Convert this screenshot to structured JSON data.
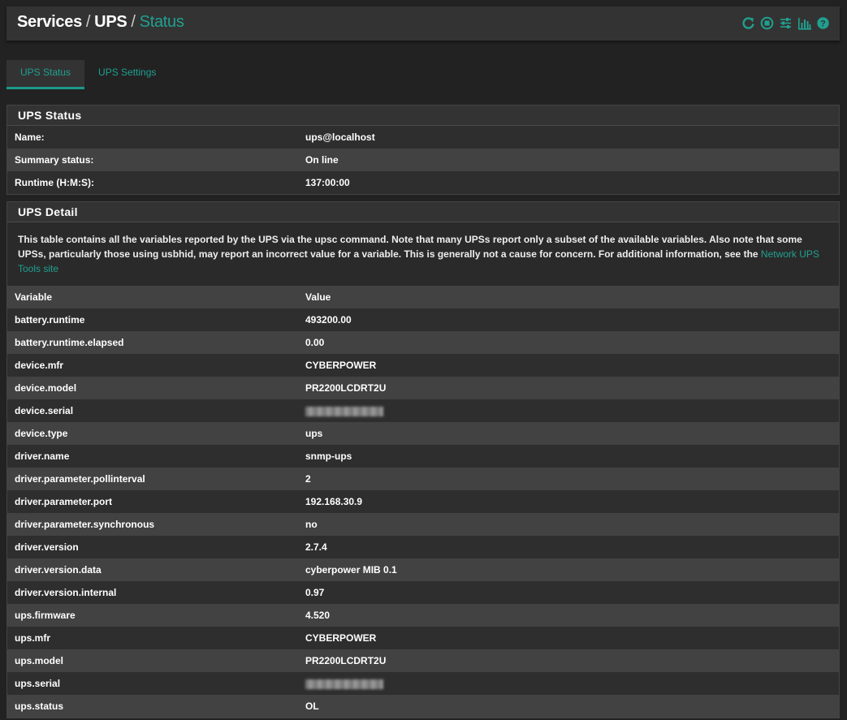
{
  "breadcrumb": {
    "services": "Services",
    "sep1": "/",
    "ups": "UPS",
    "sep2": "/",
    "status": "Status"
  },
  "header_icons": [
    "restart-icon",
    "stop-icon",
    "settings-sliders-icon",
    "chart-icon",
    "help-icon"
  ],
  "tabs": [
    {
      "label": "UPS Status"
    },
    {
      "label": "UPS Settings"
    }
  ],
  "status_panel": {
    "title": "UPS Status",
    "rows": [
      {
        "key": "Name:",
        "value": "ups@localhost"
      },
      {
        "key": "Summary status:",
        "value": "On line"
      },
      {
        "key": "Runtime (H:M:S):",
        "value": "137:00:00"
      }
    ]
  },
  "detail_panel": {
    "title": "UPS Detail",
    "description": "This table contains all the variables reported by the UPS via the upsc command. Note that many UPSs report only a subset of the available variables. Also note that some UPSs, particularly those using usbhid, may report an incorrect value for a variable. This is generally not a cause for concern. For additional information, see the",
    "link_text": "Network UPS Tools site",
    "col_variable": "Variable",
    "col_value": "Value",
    "rows": [
      {
        "key": "battery.runtime",
        "value": "493200.00"
      },
      {
        "key": "battery.runtime.elapsed",
        "value": "0.00"
      },
      {
        "key": "device.mfr",
        "value": "CYBERPOWER"
      },
      {
        "key": "device.model",
        "value": "PR2200LCDRT2U"
      },
      {
        "key": "device.serial",
        "value": "",
        "redacted": true
      },
      {
        "key": "device.type",
        "value": "ups"
      },
      {
        "key": "driver.name",
        "value": "snmp-ups"
      },
      {
        "key": "driver.parameter.pollinterval",
        "value": "2"
      },
      {
        "key": "driver.parameter.port",
        "value": "192.168.30.9"
      },
      {
        "key": "driver.parameter.synchronous",
        "value": "no"
      },
      {
        "key": "driver.version",
        "value": "2.7.4"
      },
      {
        "key": "driver.version.data",
        "value": "cyberpower MIB 0.1"
      },
      {
        "key": "driver.version.internal",
        "value": "0.97"
      },
      {
        "key": "ups.firmware",
        "value": "4.520"
      },
      {
        "key": "ups.mfr",
        "value": "CYBERPOWER"
      },
      {
        "key": "ups.model",
        "value": "PR2200LCDRT2U"
      },
      {
        "key": "ups.serial",
        "value": "",
        "redacted": true
      },
      {
        "key": "ups.status",
        "value": "OL"
      }
    ]
  },
  "colors": {
    "accent": "#20a090",
    "background": "#222222",
    "panel": "#333333"
  }
}
